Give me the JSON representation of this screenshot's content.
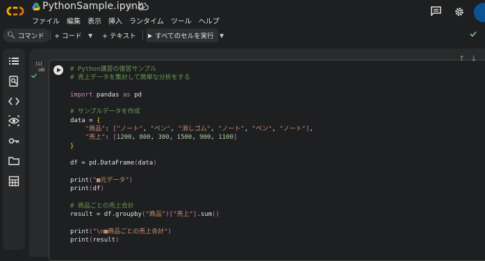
{
  "app": {
    "notebook_title": "PythonSample.ipynb",
    "menu": [
      "ファイル",
      "編集",
      "表示",
      "挿入",
      "ランタイム",
      "ツール",
      "ヘルプ"
    ]
  },
  "toolbar": {
    "command_label": "コマンド",
    "add_code_label": "+ コード",
    "add_text_label": "+ テキスト",
    "run_all_label": "すべてのセルを実行"
  },
  "cell": {
    "exec_count": "[1]",
    "exec_time": "0秒",
    "code_lines": [
      {
        "t": "comment",
        "v": "# Python講習の復習サンプル"
      },
      {
        "t": "comment",
        "v": "# 売上データを集計して簡単な分析をする"
      },
      {
        "t": "blank",
        "v": ""
      },
      {
        "t": "import",
        "kw1": "import",
        "mid": " pandas ",
        "kw2": "as",
        "end": " pd"
      },
      {
        "t": "blank",
        "v": ""
      },
      {
        "t": "comment",
        "v": "# サンプルデータを作成"
      },
      {
        "t": "plain",
        "v": "data = {"
      },
      {
        "t": "plain",
        "v": "    \"商品\": [\"ノート\", \"ペン\", \"消しゴム\", \"ノート\", \"ペン\", \"ノート\"],"
      },
      {
        "t": "plain",
        "v": "    \"売上\": [1200, 800, 300, 1500, 900, 1100]"
      },
      {
        "t": "plain",
        "v": "}"
      },
      {
        "t": "blank",
        "v": ""
      },
      {
        "t": "plain",
        "v": "df = pd.DataFrame(data)"
      },
      {
        "t": "blank",
        "v": ""
      },
      {
        "t": "plain",
        "v": "print(\"■元データ\")"
      },
      {
        "t": "plain",
        "v": "print(df)"
      },
      {
        "t": "blank",
        "v": ""
      },
      {
        "t": "comment",
        "v": "# 商品ごとの売上合計"
      },
      {
        "t": "plain",
        "v": "result = df.groupby(\"商品\")[\"売上\"].sum()"
      },
      {
        "t": "blank",
        "v": ""
      },
      {
        "t": "plain",
        "v": "print(\"\\n■商品ごとの売上合計\")"
      },
      {
        "t": "plain",
        "v": "print(result)"
      }
    ]
  },
  "colors": {
    "comment": "#6a9955",
    "keyword": "#c586c0",
    "string": "#ce9178",
    "number": "#b5cea8",
    "background": "#1e1f20"
  }
}
